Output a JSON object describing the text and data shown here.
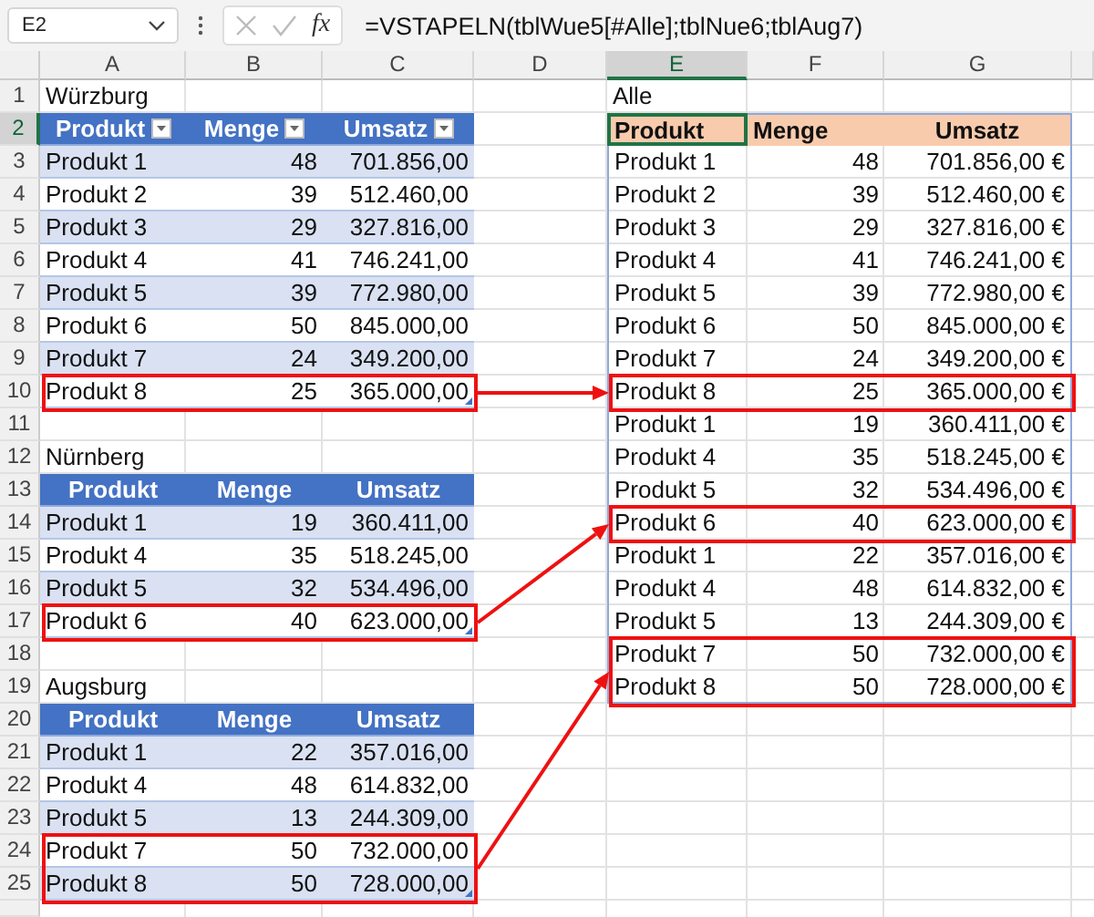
{
  "formula_bar": {
    "name_box": "E2",
    "function_label": "fx",
    "formula": "=VSTAPELN(tblWue5[#Alle];tblNue6;tblAug7)"
  },
  "column_headers": [
    {
      "label": "A",
      "selected": false
    },
    {
      "label": "B",
      "selected": false
    },
    {
      "label": "C",
      "selected": false
    },
    {
      "label": "D",
      "selected": false
    },
    {
      "label": "E",
      "selected": true
    },
    {
      "label": "F",
      "selected": false
    },
    {
      "label": "G",
      "selected": false
    }
  ],
  "row_headers": [
    {
      "label": "1",
      "selected": false
    },
    {
      "label": "2",
      "selected": true
    },
    {
      "label": "3",
      "selected": false
    },
    {
      "label": "4",
      "selected": false
    },
    {
      "label": "5",
      "selected": false
    },
    {
      "label": "6",
      "selected": false
    },
    {
      "label": "7",
      "selected": false
    },
    {
      "label": "8",
      "selected": false
    },
    {
      "label": "9",
      "selected": false
    },
    {
      "label": "10",
      "selected": false
    },
    {
      "label": "11",
      "selected": false
    },
    {
      "label": "12",
      "selected": false
    },
    {
      "label": "13",
      "selected": false
    },
    {
      "label": "14",
      "selected": false
    },
    {
      "label": "15",
      "selected": false
    },
    {
      "label": "16",
      "selected": false
    },
    {
      "label": "17",
      "selected": false
    },
    {
      "label": "18",
      "selected": false
    },
    {
      "label": "19",
      "selected": false
    },
    {
      "label": "20",
      "selected": false
    },
    {
      "label": "21",
      "selected": false
    },
    {
      "label": "22",
      "selected": false
    },
    {
      "label": "23",
      "selected": false
    },
    {
      "label": "24",
      "selected": false
    },
    {
      "label": "25",
      "selected": false
    }
  ],
  "source_tables": [
    {
      "title": "Würzburg",
      "filter_buttons": true,
      "columns": [
        "Produkt",
        "Menge",
        "Umsatz"
      ],
      "rows": [
        {
          "cells": [
            "Produkt 1",
            "48",
            "701.856,00"
          ],
          "highlighted": false
        },
        {
          "cells": [
            "Produkt 2",
            "39",
            "512.460,00"
          ],
          "highlighted": false
        },
        {
          "cells": [
            "Produkt 3",
            "29",
            "327.816,00"
          ],
          "highlighted": false
        },
        {
          "cells": [
            "Produkt 4",
            "41",
            "746.241,00"
          ],
          "highlighted": false
        },
        {
          "cells": [
            "Produkt 5",
            "39",
            "772.980,00"
          ],
          "highlighted": false
        },
        {
          "cells": [
            "Produkt 6",
            "50",
            "845.000,00"
          ],
          "highlighted": false
        },
        {
          "cells": [
            "Produkt 7",
            "24",
            "349.200,00"
          ],
          "highlighted": false
        },
        {
          "cells": [
            "Produkt 8",
            "25",
            "365.000,00"
          ],
          "highlighted": true
        }
      ]
    },
    {
      "title": "Nürnberg",
      "filter_buttons": false,
      "columns": [
        "Produkt",
        "Menge",
        "Umsatz"
      ],
      "rows": [
        {
          "cells": [
            "Produkt 1",
            "19",
            "360.411,00"
          ],
          "highlighted": false
        },
        {
          "cells": [
            "Produkt 4",
            "35",
            "518.245,00"
          ],
          "highlighted": false
        },
        {
          "cells": [
            "Produkt 5",
            "32",
            "534.496,00"
          ],
          "highlighted": false
        },
        {
          "cells": [
            "Produkt 6",
            "40",
            "623.000,00"
          ],
          "highlighted": true
        }
      ]
    },
    {
      "title": "Augsburg",
      "filter_buttons": false,
      "columns": [
        "Produkt",
        "Menge",
        "Umsatz"
      ],
      "rows": [
        {
          "cells": [
            "Produkt 1",
            "22",
            "357.016,00"
          ],
          "highlighted": false
        },
        {
          "cells": [
            "Produkt 4",
            "48",
            "614.832,00"
          ],
          "highlighted": false
        },
        {
          "cells": [
            "Produkt 5",
            "13",
            "244.309,00"
          ],
          "highlighted": false
        },
        {
          "cells": [
            "Produkt 7",
            "50",
            "732.000,00"
          ],
          "highlighted": true
        },
        {
          "cells": [
            "Produkt 8",
            "50",
            "728.000,00"
          ],
          "highlighted": true
        }
      ]
    }
  ],
  "result": {
    "title": "Alle",
    "columns": [
      "Produkt",
      "Menge",
      "Umsatz"
    ],
    "rows": [
      {
        "cells": [
          "Produkt 1",
          "48",
          "701.856,00 €"
        ],
        "highlighted": false
      },
      {
        "cells": [
          "Produkt 2",
          "39",
          "512.460,00 €"
        ],
        "highlighted": false
      },
      {
        "cells": [
          "Produkt 3",
          "29",
          "327.816,00 €"
        ],
        "highlighted": false
      },
      {
        "cells": [
          "Produkt 4",
          "41",
          "746.241,00 €"
        ],
        "highlighted": false
      },
      {
        "cells": [
          "Produkt 5",
          "39",
          "772.980,00 €"
        ],
        "highlighted": false
      },
      {
        "cells": [
          "Produkt 6",
          "50",
          "845.000,00 €"
        ],
        "highlighted": false
      },
      {
        "cells": [
          "Produkt 7",
          "24",
          "349.200,00 €"
        ],
        "highlighted": false
      },
      {
        "cells": [
          "Produkt 8",
          "25",
          "365.000,00 €"
        ],
        "highlighted": true
      },
      {
        "cells": [
          "Produkt 1",
          "19",
          "360.411,00 €"
        ],
        "highlighted": false
      },
      {
        "cells": [
          "Produkt 4",
          "35",
          "518.245,00 €"
        ],
        "highlighted": false
      },
      {
        "cells": [
          "Produkt 5",
          "32",
          "534.496,00 €"
        ],
        "highlighted": false
      },
      {
        "cells": [
          "Produkt 6",
          "40",
          "623.000,00 €"
        ],
        "highlighted": true
      },
      {
        "cells": [
          "Produkt 1",
          "22",
          "357.016,00 €"
        ],
        "highlighted": false
      },
      {
        "cells": [
          "Produkt 4",
          "48",
          "614.832,00 €"
        ],
        "highlighted": false
      },
      {
        "cells": [
          "Produkt 5",
          "13",
          "244.309,00 €"
        ],
        "highlighted": false
      },
      {
        "cells": [
          "Produkt 7",
          "50",
          "732.000,00 €"
        ],
        "highlighted": true
      },
      {
        "cells": [
          "Produkt 8",
          "50",
          "728.000,00 €"
        ],
        "highlighted": true
      }
    ]
  }
}
